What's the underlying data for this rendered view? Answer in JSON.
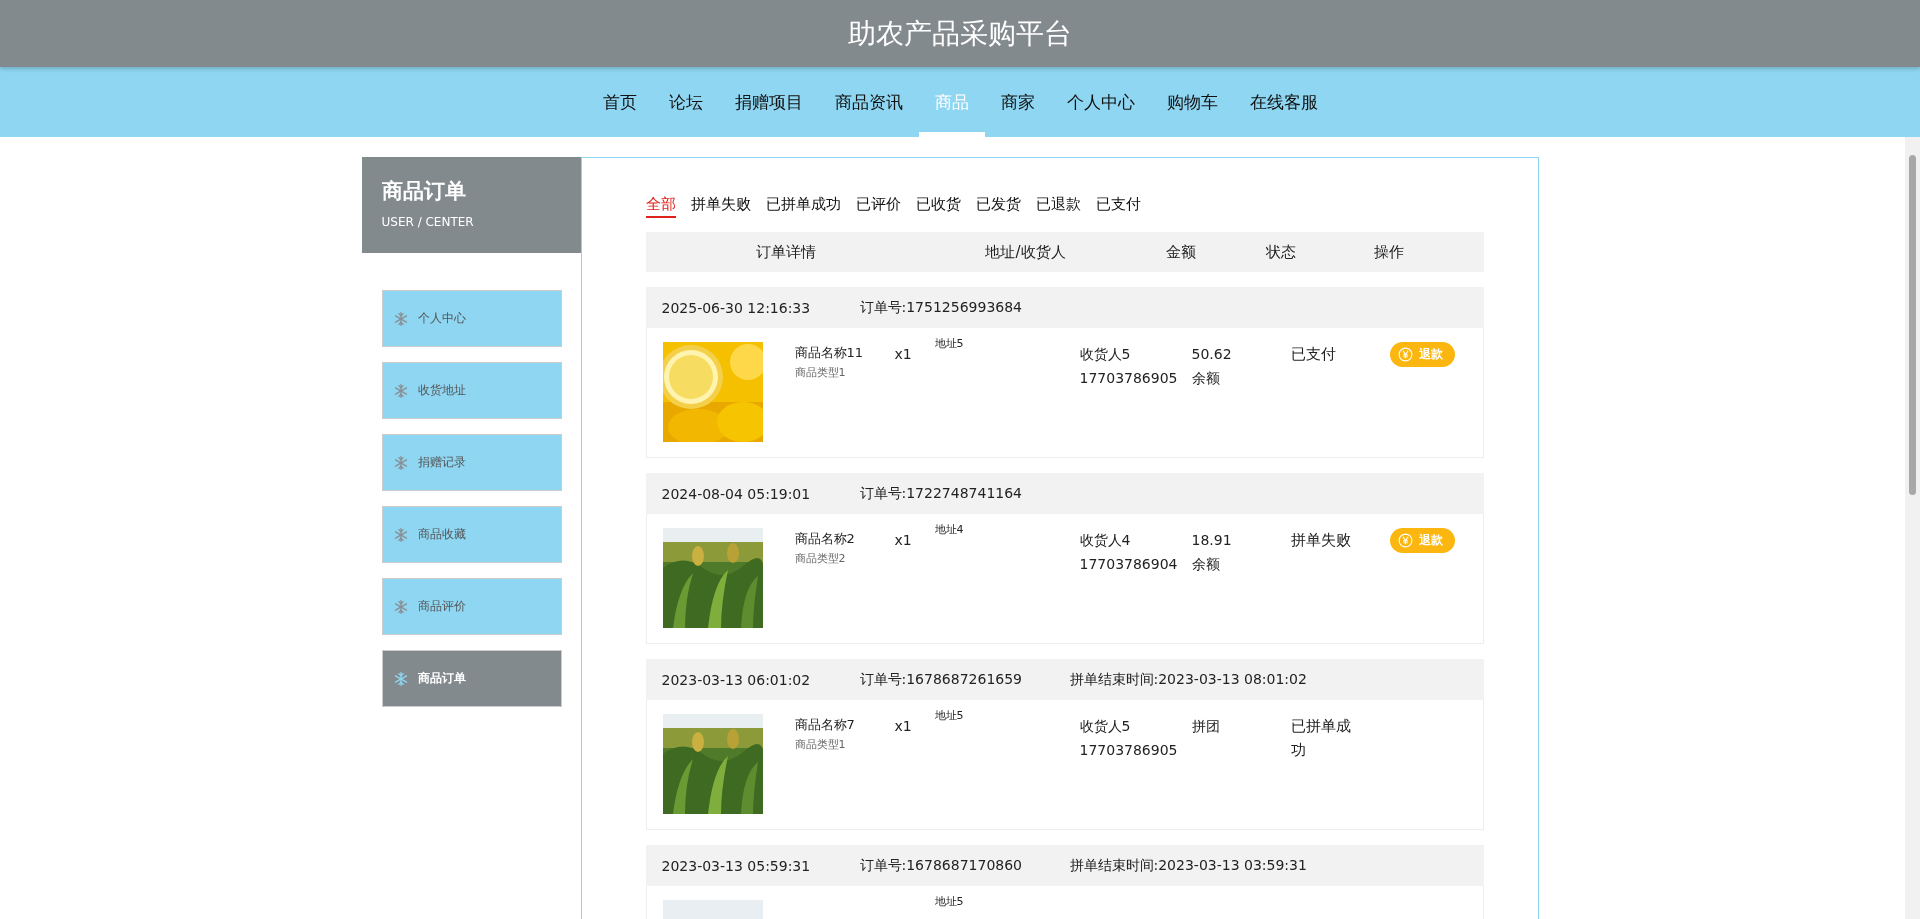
{
  "site_title": "助农产品采购平台",
  "nav": [
    {
      "label": "首页",
      "selected": false
    },
    {
      "label": "论坛",
      "selected": false
    },
    {
      "label": "捐赠项目",
      "selected": false
    },
    {
      "label": "商品资讯",
      "selected": false
    },
    {
      "label": "商品",
      "selected": true
    },
    {
      "label": "商家",
      "selected": false
    },
    {
      "label": "个人中心",
      "selected": false
    },
    {
      "label": "购物车",
      "selected": false
    },
    {
      "label": "在线客服",
      "selected": false
    }
  ],
  "sidebar": {
    "title": "商品订单",
    "subtitle": "USER / CENTER",
    "items": [
      {
        "label": "个人中心",
        "selected": false
      },
      {
        "label": "收货地址",
        "selected": false
      },
      {
        "label": "捐赠记录",
        "selected": false
      },
      {
        "label": "商品收藏",
        "selected": false
      },
      {
        "label": "商品评价",
        "selected": false
      },
      {
        "label": "商品订单",
        "selected": true
      }
    ]
  },
  "filters": [
    {
      "label": "全部",
      "selected": true
    },
    {
      "label": "拼单失败",
      "selected": false
    },
    {
      "label": "已拼单成功",
      "selected": false
    },
    {
      "label": "已评价",
      "selected": false
    },
    {
      "label": "已收货",
      "selected": false
    },
    {
      "label": "已发货",
      "selected": false
    },
    {
      "label": "已退款",
      "selected": false
    },
    {
      "label": "已支付",
      "selected": false
    }
  ],
  "table": {
    "columns": [
      "订单详情",
      "地址/收货人",
      "金额",
      "状态",
      "操作"
    ],
    "orders": [
      {
        "time": "2025-06-30 12:16:33",
        "order_no": "订单号:1751256993684",
        "name": "商品名称11",
        "type": "商品类型1",
        "qty": "x1",
        "address": "地址5",
        "receiver": "收货人5",
        "phone": "17703786905",
        "amount": "50.62",
        "payment": "余额",
        "status": "已支付",
        "action": "退款"
      },
      {
        "time": "2024-08-04 05:19:01",
        "order_no": "订单号:1722748741164",
        "name": "商品名称2",
        "type": "商品类型2",
        "qty": "x1",
        "address": "地址4",
        "receiver": "收货人4",
        "phone": "17703786904",
        "amount": "18.91",
        "payment": "余额",
        "status": "拼单失败",
        "action": "退款"
      },
      {
        "time": "2023-03-13 06:01:02",
        "order_no": "订单号:1678687261659",
        "end_time": "拼单结束时间:2023-03-13 08:01:02",
        "name": "商品名称7",
        "type": "商品类型1",
        "qty": "x1",
        "address": "地址5",
        "receiver": "收货人5",
        "phone": "17703786905",
        "amount": "拼团",
        "status": "已拼单成功"
      },
      {
        "time": "2023-03-13 05:59:31",
        "order_no": "订单号:1678687170860",
        "end_time": "拼单结束时间:2023-03-13 03:59:31",
        "address": "地址5"
      }
    ]
  }
}
